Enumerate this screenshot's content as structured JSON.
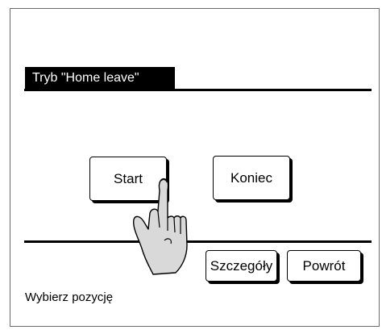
{
  "screen": {
    "title": "Tryb \"Home leave\"",
    "prompt": "Wybierz pozycję"
  },
  "buttons": {
    "start": "Start",
    "end": "Koniec",
    "details": "Szczegóły",
    "back": "Powrót"
  },
  "icons": {
    "hand": "pointing-hand-icon"
  },
  "colors": {
    "title_bar_bg": "#000000",
    "title_bar_text": "#ffffff",
    "hand_fill": "#d9d9d9"
  }
}
